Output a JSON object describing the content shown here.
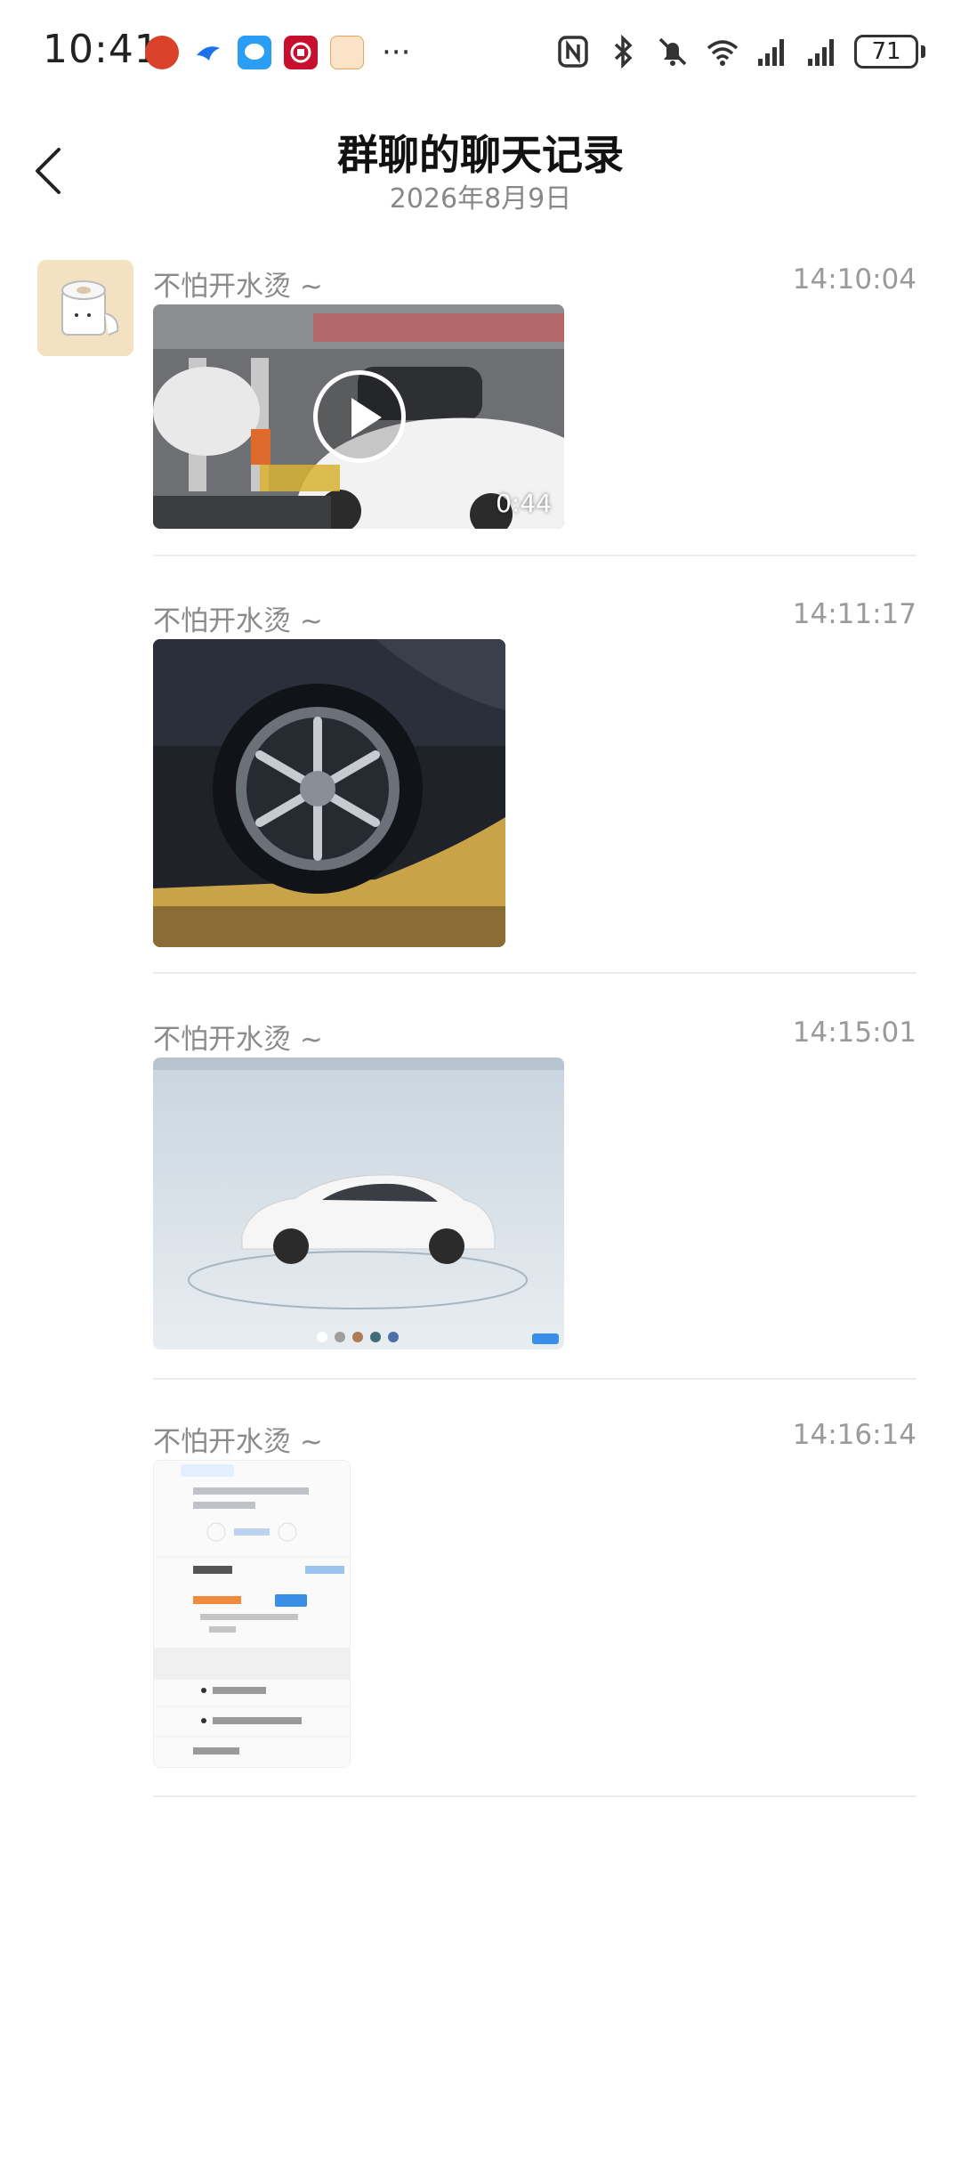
{
  "status_bar": {
    "time": "10:41",
    "more": "···",
    "battery": "71"
  },
  "header": {
    "title": "群聊的聊天记录",
    "date": "2026年8月9日"
  },
  "messages": [
    {
      "sender": "不怕开水烫 ~",
      "time": "14:10:04",
      "type": "video",
      "duration": "0:44"
    },
    {
      "sender": "不怕开水烫 ~",
      "time": "14:11:17",
      "type": "image"
    },
    {
      "sender": "不怕开水烫 ~",
      "time": "14:15:01",
      "type": "image"
    },
    {
      "sender": "不怕开水烫 ~",
      "time": "14:16:14",
      "type": "image"
    }
  ],
  "colors": {
    "background": "#ffffff",
    "sender_text": "#8a8a8a",
    "time_text": "#9a9a9a",
    "divider": "#ececec"
  }
}
